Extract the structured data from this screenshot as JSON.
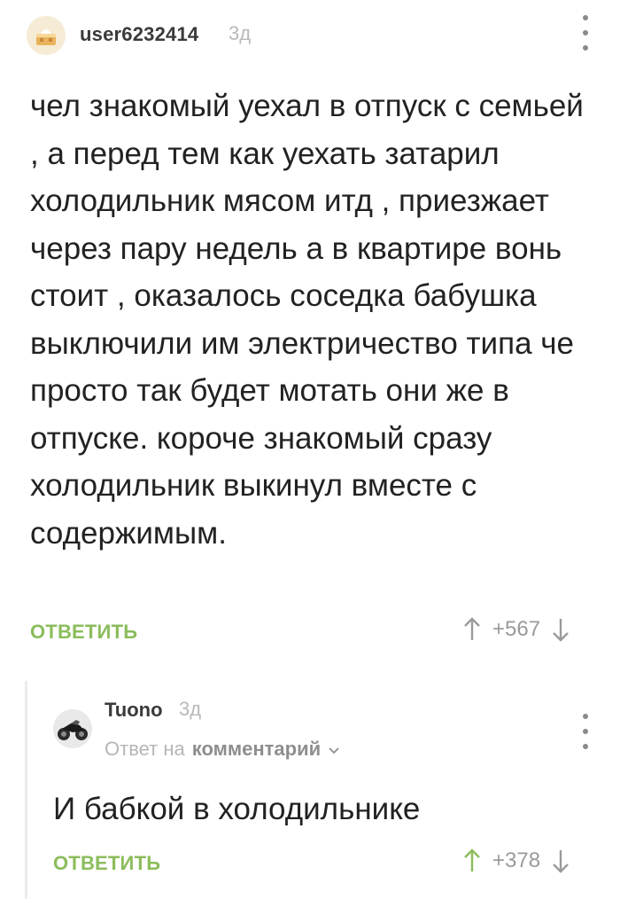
{
  "comment": {
    "username": "user6232414",
    "time": "3д",
    "body": "чел знакомый уехал в отпуск с семьей , а перед тем как уехать затарил холодильник мясом итд , приезжает через пару недель а в квартире вонь стоит , оказалось соседка бабушка выключили им электричество типа че просто так будет мотать они же в отпуске. короче знакомый сразу холодильник выкинул вместе с содержимым.",
    "reply_label": "ОТВЕТИТЬ",
    "rating": "+567"
  },
  "reply": {
    "username": "Tuono",
    "time": "3д",
    "reply_to_prefix": "Ответ на",
    "reply_to_link": "комментарий",
    "body": "И бабкой в холодильнике",
    "reply_label": "ОТВЕТИТЬ",
    "rating": "+378"
  },
  "colors": {
    "accent_green": "#8bbd5c",
    "up_arrow_active": "#8bbd5c",
    "muted": "#9a9a9a"
  },
  "icons": {
    "avatar_user": "cake-avatar-icon",
    "avatar_tuono": "motorcycle-avatar-icon",
    "menu": "kebab-menu-icon",
    "up": "arrow-up-icon",
    "down": "arrow-down-icon",
    "chevron": "chevron-down-icon"
  }
}
